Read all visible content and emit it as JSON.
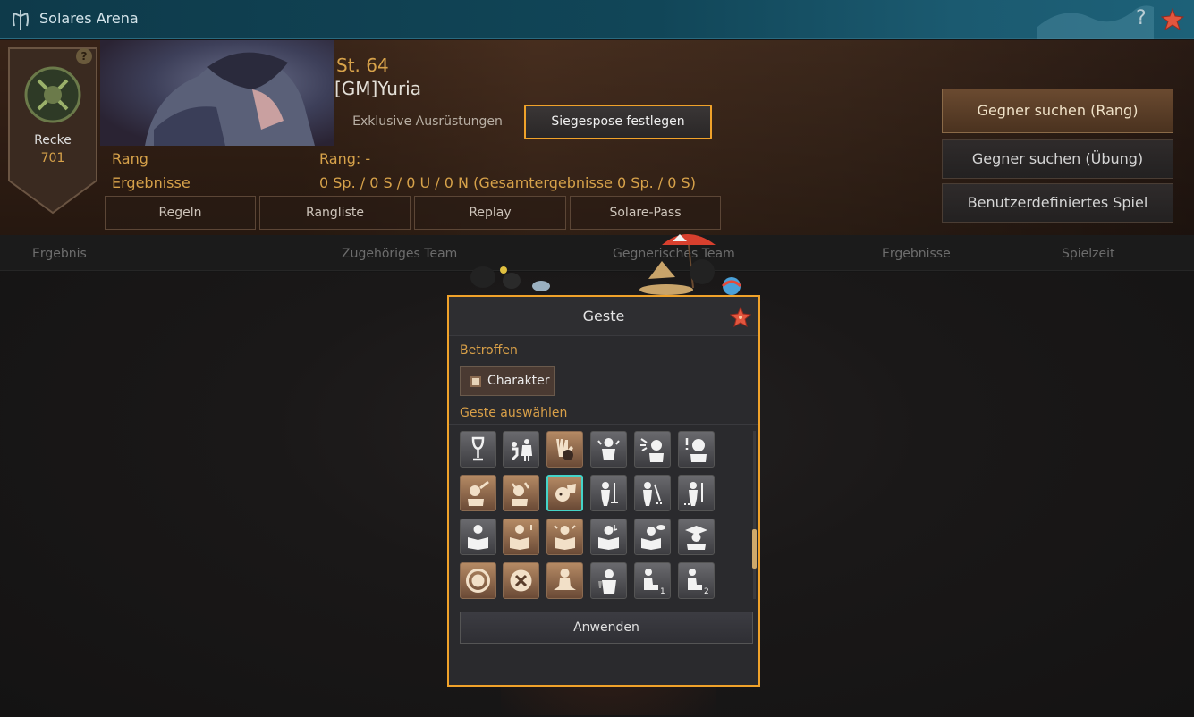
{
  "window": {
    "title": "Solares Arena",
    "help": "?"
  },
  "player": {
    "badge_class": "Recke",
    "badge_points": "701",
    "badge_help": "?",
    "level": "St. 64",
    "name": "[GM]Yuria",
    "exclusive_btn": "Exklusive Ausrüstungen",
    "victory_pose_btn": "Siegespose festlegen"
  },
  "stats": {
    "rank_label": "Rang",
    "rank_value": "Rang: -",
    "results_label": "Ergebnisse",
    "results_value": "0 Sp.  / 0 S / 0 U / 0 N (Gesamtergebnisse 0 Sp. / 0 S)"
  },
  "tabs": [
    "Regeln",
    "Rangliste",
    "Replay",
    "Solare-Pass"
  ],
  "matchmaking": {
    "ranked": "Gegner suchen (Rang)",
    "practice": "Gegner suchen (Übung)",
    "custom": "Benutzerdefiniertes Spiel"
  },
  "table": {
    "columns": [
      "Ergebnis",
      "Zugehöriges Team",
      "Gegnerisches Team",
      "Ergebnisse",
      "Spielzeit"
    ]
  },
  "dialog": {
    "title": "Geste",
    "target_label": "Betroffen",
    "target_option": "Charakter",
    "select_label": "Geste auswählen",
    "apply": "Anwenden",
    "icons": [
      [
        "wine-glass-icon",
        "proposal-icon",
        "stop-hand-icon",
        "confused-icon",
        "shout-icon",
        "surprised-icon"
      ],
      [
        "bravo-icon",
        "cheer-icon",
        "wave-icon",
        "sweep-icon",
        "sweep-2-icon",
        "sweep-3-icon"
      ],
      [
        "read-icon",
        "read-alert-icon",
        "read-worried-icon",
        "read-music-icon",
        "read-think-icon",
        "graduate-icon"
      ],
      [
        "circle-icon",
        "x-mark-icon",
        "meditate-icon",
        "drink-icon",
        "sit-1-icon",
        "sit-2-icon"
      ]
    ]
  },
  "colors": {
    "accent": "#f0a22a",
    "gold": "#d7a24a",
    "selected": "#44d4c8"
  }
}
